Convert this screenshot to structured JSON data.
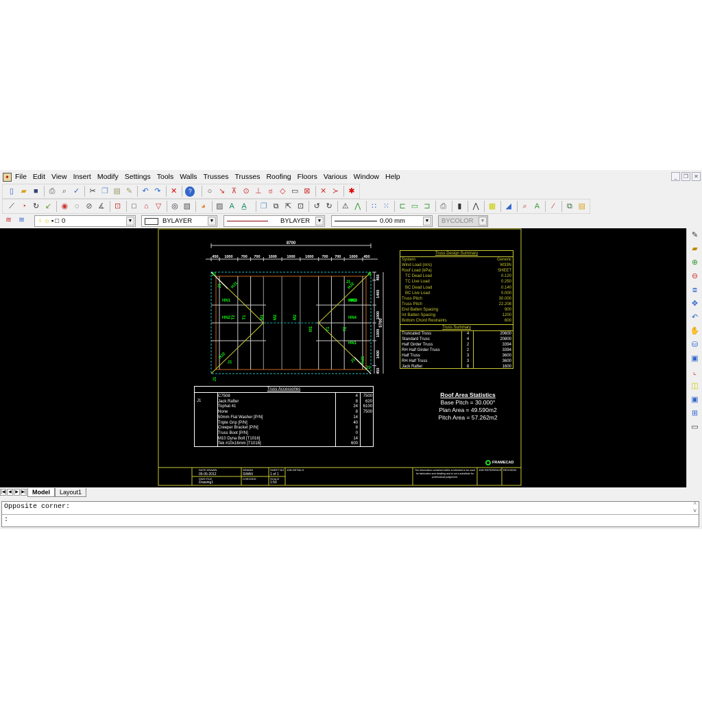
{
  "menu": [
    "File",
    "Edit",
    "View",
    "Insert",
    "Modify",
    "Settings",
    "Tools",
    "Walls",
    "Trusses",
    "Trusses",
    "Roofing",
    "Floors",
    "Various",
    "Window",
    "Help"
  ],
  "window_buttons": [
    "_",
    "❐",
    "✕"
  ],
  "toolbar1": [
    "new-file",
    "open-folder",
    "save",
    "|",
    "print",
    "print-preview",
    "spell-check",
    "|",
    "cut",
    "copy",
    "paste",
    "match-properties",
    "|",
    "undo",
    "redo",
    "|",
    "erase",
    "|",
    "help",
    "||",
    "snap-circle",
    "snap-endpoint",
    "snap-midpoint",
    "snap-center",
    "snap-perpendicular",
    "snap-tangent",
    "snap-quadrant",
    "snap-insert",
    "snap-node",
    "|",
    "snap-intersection",
    "snap-apparent",
    "|",
    "snap-none"
  ],
  "toolbar2": [
    "line",
    "circle",
    "arc",
    "polyline",
    "|",
    "dim-circle",
    "dim-radius",
    "dim-diameter",
    "dim-angle",
    "|",
    "block",
    "|",
    "rectangle",
    "house",
    "polygon",
    "|",
    "donut",
    "hatch",
    "|",
    "insert-image",
    "|",
    "region",
    "text",
    "text-style",
    "||",
    "copy",
    "array",
    "move",
    "scale",
    "|",
    "rotate",
    "rotate-copy",
    "|",
    "mirror",
    "mirror-copy",
    "|",
    "grid",
    "grid-dense",
    "|",
    "box-open",
    "box",
    "box-side",
    "|",
    "plot",
    "|",
    "bar-chart",
    "|",
    "roof-hip",
    "|",
    "ruler",
    "|",
    "gradient",
    "|",
    "zoom-properties",
    "paint-text",
    "|",
    "magic-wand",
    "|",
    "layers",
    "properties"
  ],
  "layer_bar": {
    "layer": "0",
    "color": "BYLAYER",
    "linetype": "BYLAYER",
    "lineweight": "0.00 mm",
    "plotstyle": "BYCOLOR"
  },
  "right_toolbar": [
    "pencil",
    "eraser",
    "zoom-in",
    "zoom-out",
    "zoom-window",
    "zoom-extents",
    "zoom-previous",
    "pan",
    "view-3d",
    "view-top",
    "view-axis",
    "view-iso",
    "view-save",
    "grid-layout",
    "text-box"
  ],
  "plan": {
    "overall_width": "8700",
    "overall_depth": "5700",
    "width_dims": [
      "450",
      "1000",
      "700",
      "700",
      "1000",
      "1000",
      "1000",
      "700",
      "700",
      "1000",
      "450"
    ],
    "depth_dims": [
      "450",
      "1400",
      "1000",
      "1000",
      "1400",
      "450"
    ],
    "truss_labels": [
      "J1",
      "J1",
      "HJ1",
      "HN1",
      "HN2",
      "T2",
      "T1",
      "M1",
      "M2",
      "M2",
      "M1",
      "T1",
      "T2",
      "HN3",
      "HN4",
      "HN1",
      "J1",
      "HJ2",
      "HN3",
      "HJ2",
      "J1",
      "J1",
      "HJ1",
      "J1",
      "J1",
      "J1"
    ]
  },
  "design_summary": {
    "title": "Truss Design Summary",
    "rows": [
      [
        "System",
        "Generic"
      ],
      [
        "Wind Load (m/s)",
        "W33N"
      ],
      [
        "Roof Load (kPa)",
        "SHEET"
      ],
      [
        "  TC Dead Load",
        "0.120"
      ],
      [
        "  TC Live Load",
        "0.250"
      ],
      [
        "  BC Dead Load",
        "0.140"
      ],
      [
        "  BC Live Load",
        "0.000"
      ],
      [
        "Truss Pitch",
        "30.000"
      ],
      [
        "Truss Pitch",
        "22.208"
      ],
      [
        "End Batten Spacing",
        "900"
      ],
      [
        "Int Batten Spacing",
        "1200"
      ],
      [
        "Bottom Chord Restraints",
        "600"
      ]
    ]
  },
  "truss_summary": {
    "title": "Truss Summary",
    "rows": [
      [
        "Truncated Truss",
        "4",
        "20600"
      ],
      [
        "Standard Truss",
        "4",
        "20800"
      ],
      [
        "Half Girder Truss",
        "2",
        "3394"
      ],
      [
        "RH Half Girder Truss",
        "2",
        "3394"
      ],
      [
        "Half Truss",
        "3",
        "3600"
      ],
      [
        "RH Half Truss",
        "3",
        "3600"
      ],
      [
        "Jack Rafter",
        "8",
        "1600"
      ]
    ]
  },
  "accessories": {
    "title": "Truss Accessories",
    "group": "J1",
    "rows": [
      [
        "C7508",
        "4",
        "7500"
      ],
      [
        "Jack Rafter",
        "8",
        "620"
      ],
      [
        "Tophat 41",
        "24",
        "6100"
      ],
      [
        "None",
        "8",
        "7500"
      ],
      [
        "50mm Flat Washer   [P/N]",
        "14",
        ""
      ],
      [
        "Triple Grip   [P/N]",
        "40",
        ""
      ],
      [
        "Creeper Bracket   [P/N]",
        "8",
        ""
      ],
      [
        "Truss Boot   [P/N]",
        "0",
        ""
      ],
      [
        "M10 Dyna Bolt   [T1016]",
        "14",
        ""
      ],
      [
        "Tek #10x16mm   [T1016]",
        "600",
        ""
      ]
    ]
  },
  "roof_stats": {
    "title": "Roof Area Statistics",
    "base_pitch": "Base Pitch = 30.000°",
    "plan_area": "Plan Area = 49.590m2",
    "pitch_area": "Pitch Area = 57.262m2"
  },
  "title_block": {
    "date_label": "DATE DRAWN",
    "date": "05-05-2012",
    "drawn_label": "DRAWN",
    "drawn": "SWAN",
    "sheet_label": "SHEET NO",
    "sheet": "1 of 1",
    "file_label": "DWG FILE",
    "file": "Drawing1",
    "checked_label": "CHECKED",
    "scale_label": "SCALE",
    "scale": "1:50",
    "job_label": "JOB DETAILS",
    "disclaimer": "The information contained within is intended to be used for fabrication and detailing and is not a substitute for professional judgement.",
    "job_ref_label": "JOB REFERENCE",
    "revision_label": "REVISION",
    "logo": "FRAMECAD"
  },
  "tabs": [
    "Model",
    "Layout1"
  ],
  "command": {
    "history": "Opposite corner:",
    "prompt": ":"
  }
}
